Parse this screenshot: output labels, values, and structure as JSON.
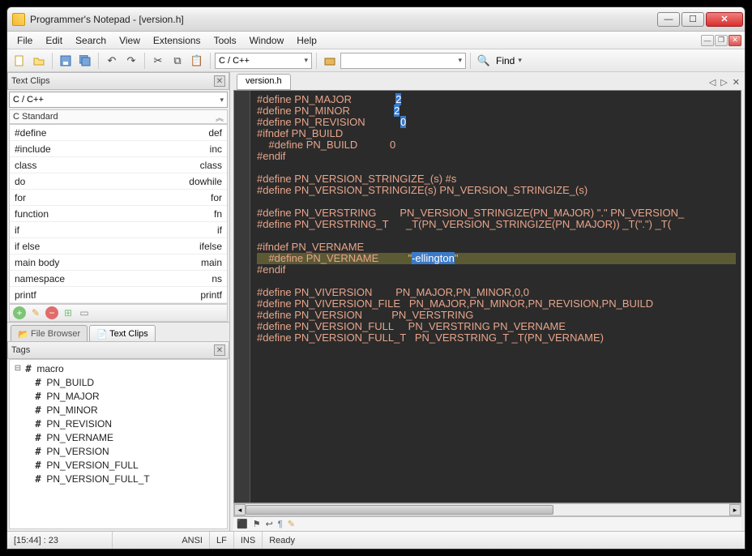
{
  "title": "Programmer's Notepad - [version.h]",
  "menus": [
    "File",
    "Edit",
    "Search",
    "View",
    "Extensions",
    "Tools",
    "Window",
    "Help"
  ],
  "toolbar": {
    "scheme_combo": "C / C++",
    "find_label": "Find"
  },
  "textclips": {
    "panel_title": "Text Clips",
    "lang_combo": "C / C++",
    "group": "C Standard",
    "items": [
      {
        "name": "#define",
        "short": "def"
      },
      {
        "name": "#include",
        "short": "inc"
      },
      {
        "name": "class",
        "short": "class"
      },
      {
        "name": "do",
        "short": "dowhile"
      },
      {
        "name": "for",
        "short": "for"
      },
      {
        "name": "function",
        "short": "fn"
      },
      {
        "name": "if",
        "short": "if"
      },
      {
        "name": "if else",
        "short": "ifelse"
      },
      {
        "name": "main body",
        "short": "main"
      },
      {
        "name": "namespace",
        "short": "ns"
      },
      {
        "name": "printf",
        "short": "printf"
      }
    ]
  },
  "bottom_tabs": {
    "file_browser": "File Browser",
    "text_clips": "Text Clips"
  },
  "tags": {
    "panel_title": "Tags",
    "root": "macro",
    "items": [
      "PN_BUILD",
      "PN_MAJOR",
      "PN_MINOR",
      "PN_REVISION",
      "PN_VERNAME",
      "PN_VERSION",
      "PN_VERSION_FULL",
      "PN_VERSION_FULL_T"
    ]
  },
  "doc_tab": "version.h",
  "code": {
    "l1_a": "#define",
    "l1_b": " PN_MAJOR",
    "l1_v": "2",
    "l2_a": "#define",
    "l2_b": " PN_MINOR",
    "l2_v": "2",
    "l3_a": "#define",
    "l3_b": " PN_REVISION",
    "l3_v": "0",
    "l4": "#ifndef PN_BUILD",
    "l5_a": "    #define",
    "l5_b": " PN_BUILD",
    "l5_v": "0",
    "l6": "#endif",
    "l8": "#define PN_VERSION_STRINGIZE_(s) #s",
    "l9": "#define PN_VERSION_STRINGIZE(s) PN_VERSION_STRINGIZE_(s)",
    "l11_a": "#define PN_VERSTRING",
    "l11_b": "PN_VERSION_STRINGIZE(PN_MAJOR) \".\" PN_VERSION_",
    "l12_a": "#define PN_VERSTRING_T",
    "l12_b": "_T(PN_VERSION_STRINGIZE(PN_MAJOR)) _T(\".\") _T(",
    "l14": "#ifndef PN_VERNAME",
    "l15_a": "    #define",
    "l15_b": " PN_VERNAME",
    "l15_q": "\"",
    "l15_hl": "-ellington",
    "l15_q2": "\"",
    "l16": "#endif",
    "l18_a": "#define PN_VIVERSION",
    "l18_b": "PN_MAJOR,PN_MINOR,0,0",
    "l19_a": "#define PN_VIVERSION_FILE",
    "l19_b": "PN_MAJOR,PN_MINOR,PN_REVISION,PN_BUILD",
    "l20_a": "#define PN_VERSION",
    "l20_b": "PN_VERSTRING",
    "l21_a": "#define PN_VERSION_FULL",
    "l21_b": "PN_VERSTRING PN_VERNAME",
    "l22_a": "#define PN_VERSION_FULL_T",
    "l22_b": "PN_VERSTRING_T _T(PN_VERNAME)"
  },
  "status": {
    "pos": "[15:44] : 23",
    "enc": "ANSI",
    "eol": "LF",
    "ins": "INS",
    "msg": "Ready"
  }
}
